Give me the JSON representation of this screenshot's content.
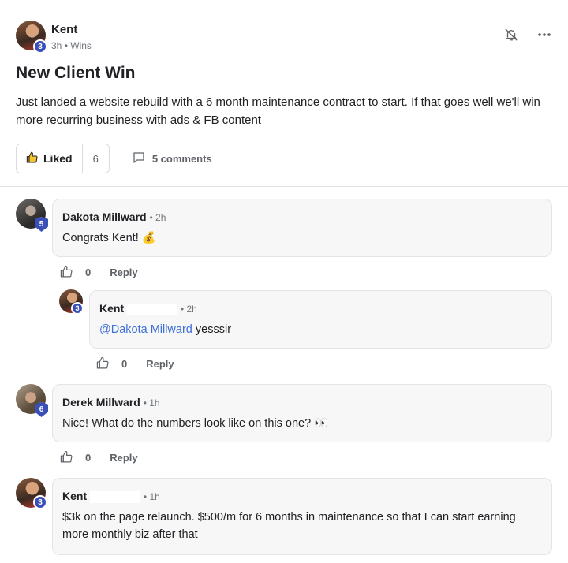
{
  "post": {
    "author": "Kent",
    "author_level": "3",
    "time": "3h",
    "separator": "•",
    "category": "Wins",
    "title": "New Client Win",
    "body": "Just landed a website rebuild with a 6 month maintenance contract to start. If that goes well we'll win more recurring business with ads & FB content",
    "like_label": "Liked",
    "like_count": "6",
    "comments_label": "5 comments",
    "icons": [
      "bell-off-icon",
      "more-icon",
      "thumbs-up-icon",
      "comment-icon"
    ]
  },
  "comments": [
    {
      "author": "Dakota Millward",
      "level": "5",
      "time": "• 2h",
      "text": "Congrats Kent! 💰",
      "likes": "0",
      "reply": "Reply"
    },
    {
      "author": "Kent",
      "level": "3",
      "time": "• 2h",
      "mention": "@Dakota Millward",
      "text": " yesssir",
      "likes": "0",
      "reply": "Reply"
    },
    {
      "author": "Derek Millward",
      "level": "6",
      "time": "• 1h",
      "text": "Nice! What do the numbers look like on this one? 👀",
      "likes": "0",
      "reply": "Reply"
    },
    {
      "author": "Kent",
      "level": "3",
      "time": "• 1h",
      "text": "$3k on the page relaunch. $500/m for 6 months in maintenance so that I can start earning more monthly biz after that"
    }
  ],
  "colors": {
    "accent": "#3b4fb8",
    "mention": "#3d6fd6",
    "bubble": "#f7f7f7"
  }
}
